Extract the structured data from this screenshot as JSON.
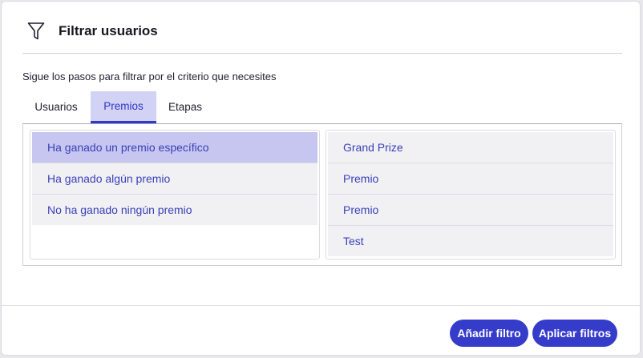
{
  "dialog": {
    "title": "Filtrar usuarios",
    "subtitle": "Sigue los pasos para filtrar por el criterio que necesites"
  },
  "tabs": [
    {
      "label": "Usuarios",
      "selected": false
    },
    {
      "label": "Premios",
      "selected": true
    },
    {
      "label": "Etapas",
      "selected": false
    }
  ],
  "criteria": [
    {
      "label": "Ha ganado un premio específico",
      "selected": true
    },
    {
      "label": "Ha ganado algún premio",
      "selected": false
    },
    {
      "label": "No ha ganado ningún premio",
      "selected": false
    }
  ],
  "prizes": [
    {
      "label": "Grand Prize"
    },
    {
      "label": "Premio"
    },
    {
      "label": "Premio"
    },
    {
      "label": "Test"
    }
  ],
  "footer": {
    "add_filter_label": "Añadir filtro",
    "apply_filters_label": "Aplicar filtros"
  },
  "icons": {
    "header": "filter-icon"
  },
  "colors": {
    "accent": "#353cca",
    "selected_bg": "#c6c6f0",
    "item_bg": "#f1f1f3",
    "item_text": "#3a40b8"
  }
}
